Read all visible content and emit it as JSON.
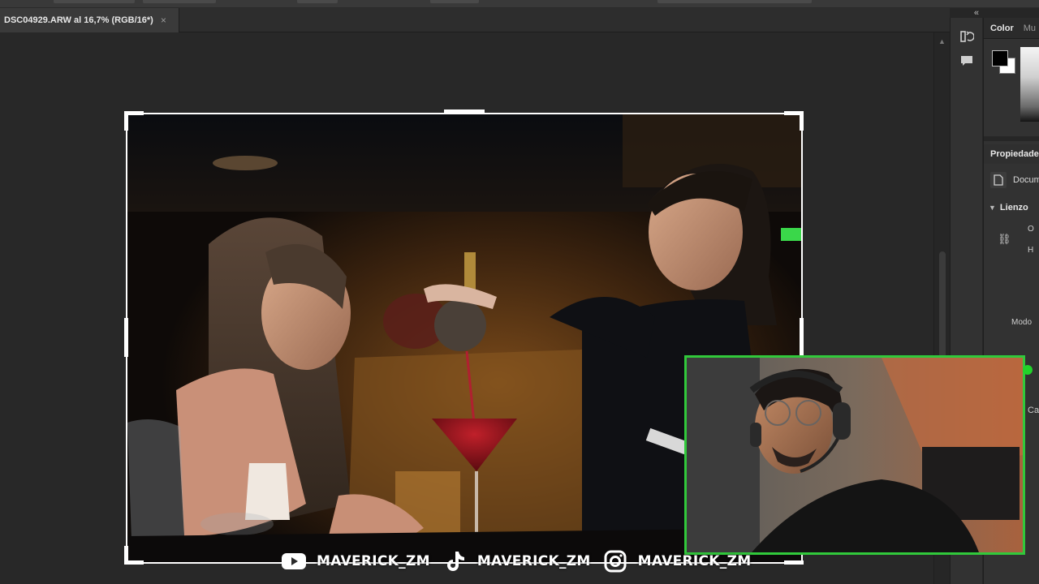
{
  "document_tab": {
    "title": "DSC04929.ARW al 16,7% (RGB/16*)",
    "close": "×"
  },
  "panel_collapse": "«",
  "color_panel": {
    "tab_active": "Color",
    "tab_inactive": "Mu",
    "foreground": "#000000",
    "background": "#ffffff"
  },
  "properties_panel": {
    "title": "Propiedades",
    "doc_label": "Docum",
    "section": "Lienzo",
    "field_w": "O",
    "field_h": "H",
    "mode_label": "Modo",
    "cut_label": "Ca"
  },
  "webcam": {
    "border_color": "#31c93b"
  },
  "social": [
    {
      "icon": "youtube-icon",
      "handle": "MAVERICK_ZM"
    },
    {
      "icon": "tiktok-icon",
      "handle": "MAVERICK_ZM"
    },
    {
      "icon": "instagram-icon",
      "handle": "MAVERICK_ZM"
    }
  ]
}
